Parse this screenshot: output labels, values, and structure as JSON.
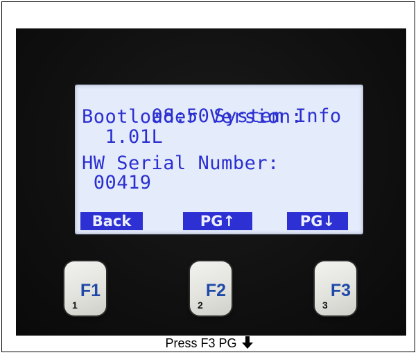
{
  "screen": {
    "time": "08:50",
    "title": "System Info",
    "lines": [
      "Bootloader Version:",
      "  1.01L",
      "HW Serial Number:",
      " 00419"
    ]
  },
  "softkeys": [
    {
      "label": "Back"
    },
    {
      "label": "PG↑"
    },
    {
      "label": "PG↓"
    }
  ],
  "function_keys": [
    {
      "label": "F1",
      "number": "1"
    },
    {
      "label": "F2",
      "number": "2"
    },
    {
      "label": "F3",
      "number": "3"
    }
  ],
  "caption": {
    "text": "Press F3 PG",
    "icon": "down-arrow-icon"
  },
  "colors": {
    "lcd_background": "#e4ebfa",
    "lcd_text": "#2b2fd0",
    "softkey_background": "#2d31d4",
    "key_label": "#1f49a8"
  }
}
